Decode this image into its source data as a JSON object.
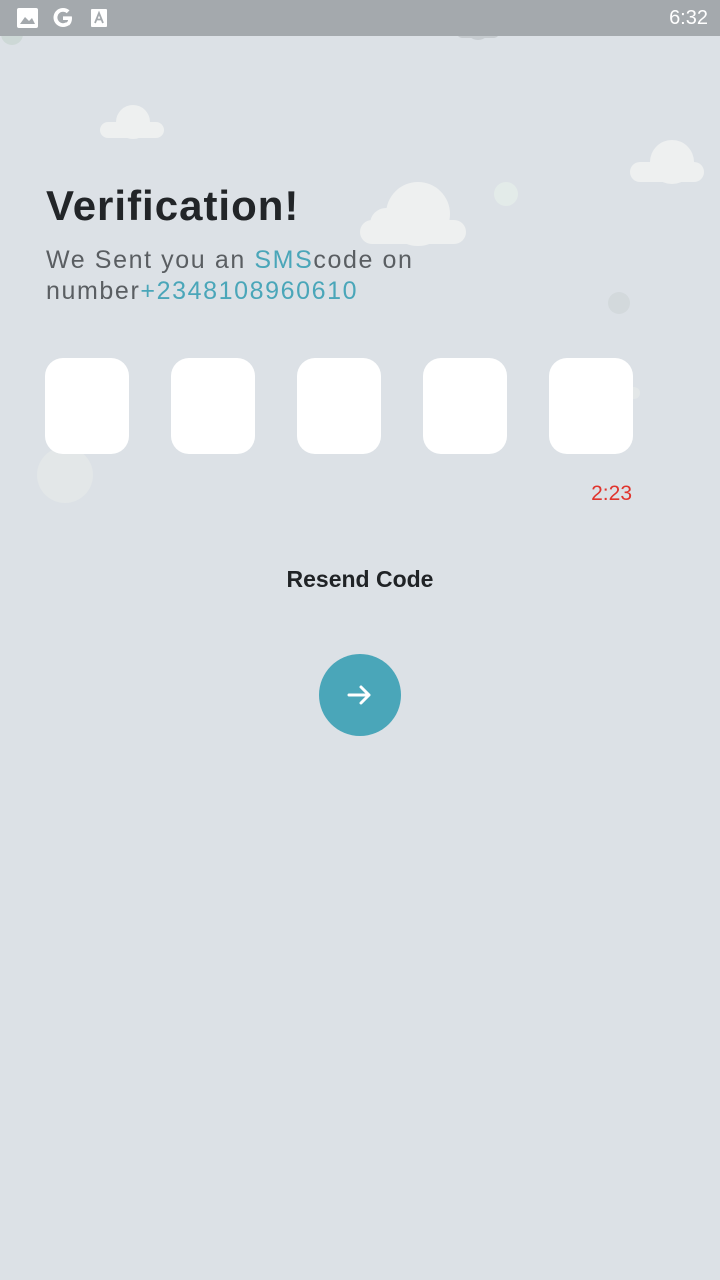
{
  "status_bar": {
    "time": "6:32",
    "icons": [
      "image-icon",
      "google-icon",
      "a-font-icon"
    ]
  },
  "verification": {
    "title": "Verification!",
    "subtitle_part1": "We Sent you an ",
    "subtitle_highlight": "SMS",
    "subtitle_part2": "code on number",
    "phone_number": "+2348108960610"
  },
  "otp": {
    "digits": [
      "",
      "",
      "",
      "",
      ""
    ]
  },
  "timer": "2:23",
  "resend_label": "Resend Code",
  "colors": {
    "background": "#dce1e6",
    "accent": "#4aa6b9",
    "timer": "#e0342d",
    "status_bar": "#a4a9ad"
  },
  "next_button_icon": "arrow-right-icon"
}
